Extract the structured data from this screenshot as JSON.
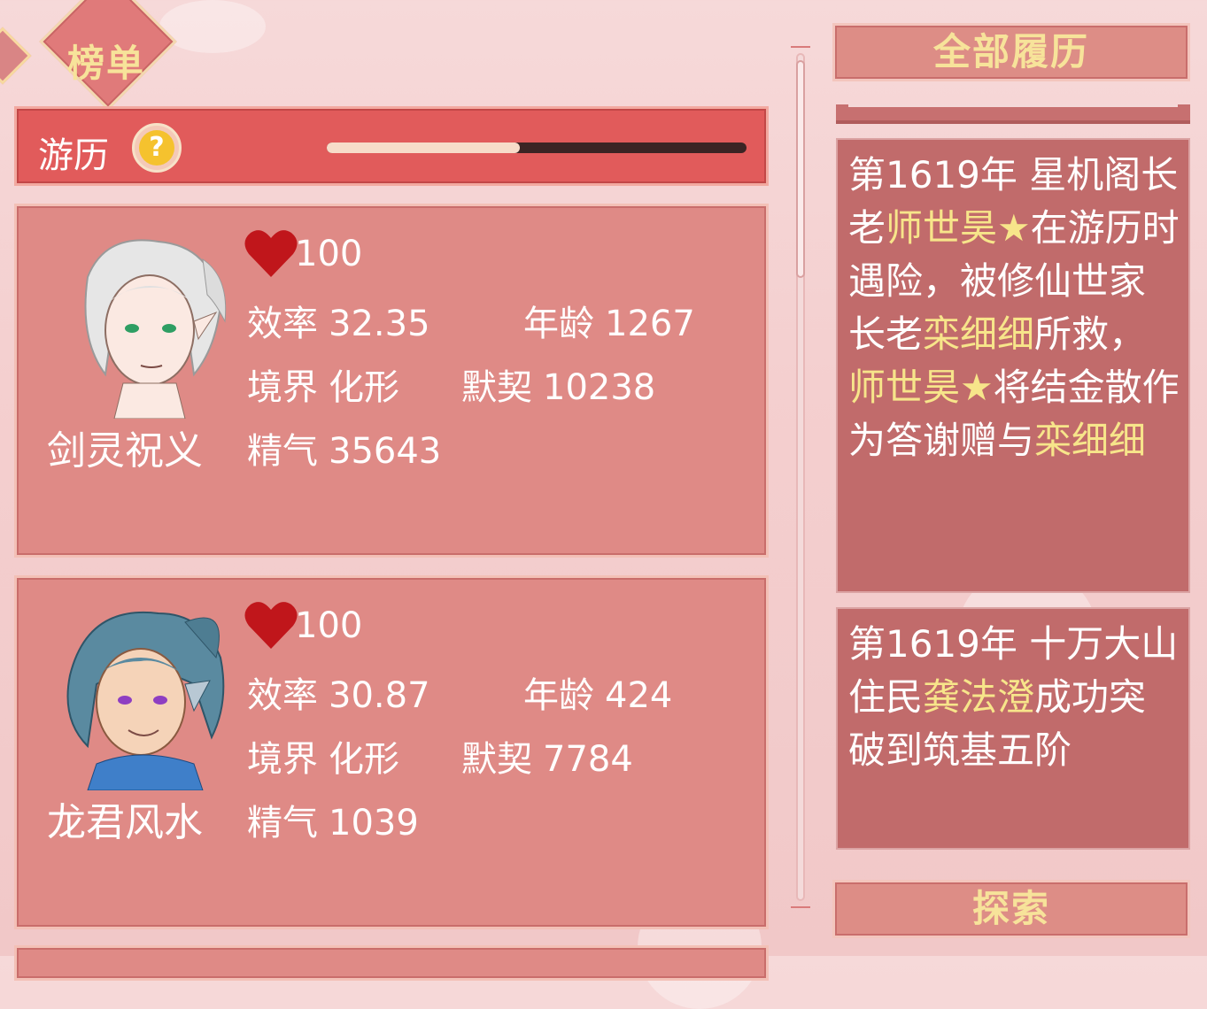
{
  "rank_tab": {
    "label": "榜单"
  },
  "travel": {
    "title": "游历",
    "help_icon": "?",
    "progress": 0.46
  },
  "characters": [
    {
      "name": "剑灵祝义",
      "favor": "100",
      "efficiency_label": "效率",
      "efficiency": "32.35",
      "age_label": "年龄",
      "age": "1267",
      "realm_label": "境界",
      "realm": "化形",
      "bond_label": "默契",
      "bond": "10238",
      "essence_label": "精气",
      "essence": "35643"
    },
    {
      "name": "龙君风水",
      "favor": "100",
      "efficiency_label": "效率",
      "efficiency": "30.87",
      "age_label": "年龄",
      "age": "424",
      "realm_label": "境界",
      "realm": "化形",
      "bond_label": "默契",
      "bond": "7784",
      "essence_label": "精气",
      "essence": "1039"
    }
  ],
  "right_panel": {
    "history_button": "全部履历",
    "explore_button": "探索",
    "log1": {
      "p1": "第1619年 星机阁长老",
      "n1": "师世昊★",
      "p2": "在游历时遇险，被修仙世家长老",
      "n2": "栾细细",
      "p3": "所救，",
      "n3": "师世昊★",
      "p4": "将结金散作为答谢赠与",
      "n4": "栾细细"
    },
    "log2": {
      "p1": "第1619年 十万大山住民",
      "n1": "龚法澄",
      "p2": "成功突破到筑基五阶"
    }
  },
  "colors": {
    "highlight": "#f7e58a",
    "heart": "#c0161b",
    "bar": "#e15b5b"
  }
}
